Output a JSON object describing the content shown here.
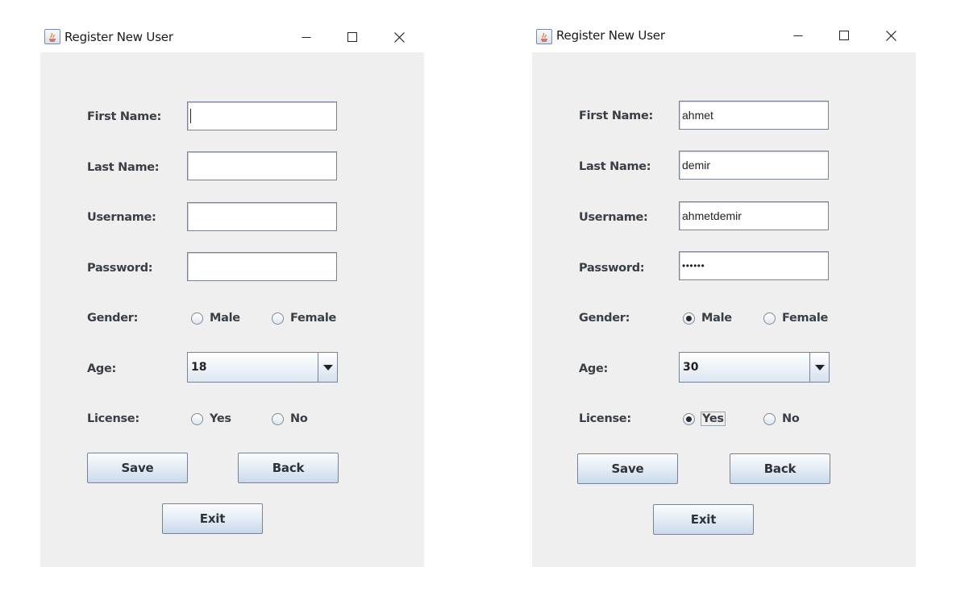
{
  "windows": [
    {
      "title": "Register New User",
      "labels": {
        "first_name": "First Name:",
        "last_name": "Last Name:",
        "username": "Username:",
        "password": "Password:",
        "gender": "Gender:",
        "age": "Age:",
        "license": "License:"
      },
      "fields": {
        "first_name": "",
        "last_name": "",
        "username": "",
        "password": ""
      },
      "gender_options": [
        "Male",
        "Female"
      ],
      "gender_selected": null,
      "age_value": "18",
      "license_options": [
        "Yes",
        "No"
      ],
      "license_selected": null,
      "buttons": {
        "save": "Save",
        "back": "Back",
        "exit": "Exit"
      }
    },
    {
      "title": "Register New User",
      "labels": {
        "first_name": "First Name:",
        "last_name": "Last Name:",
        "username": "Username:",
        "password": "Password:",
        "gender": "Gender:",
        "age": "Age:",
        "license": "License:"
      },
      "fields": {
        "first_name": "ahmet",
        "last_name": "demir",
        "username": "ahmetdemir",
        "password": "••••••"
      },
      "gender_options": [
        "Male",
        "Female"
      ],
      "gender_selected": "Male",
      "age_value": "30",
      "license_options": [
        "Yes",
        "No"
      ],
      "license_selected": "Yes",
      "buttons": {
        "save": "Save",
        "back": "Back",
        "exit": "Exit"
      }
    }
  ]
}
